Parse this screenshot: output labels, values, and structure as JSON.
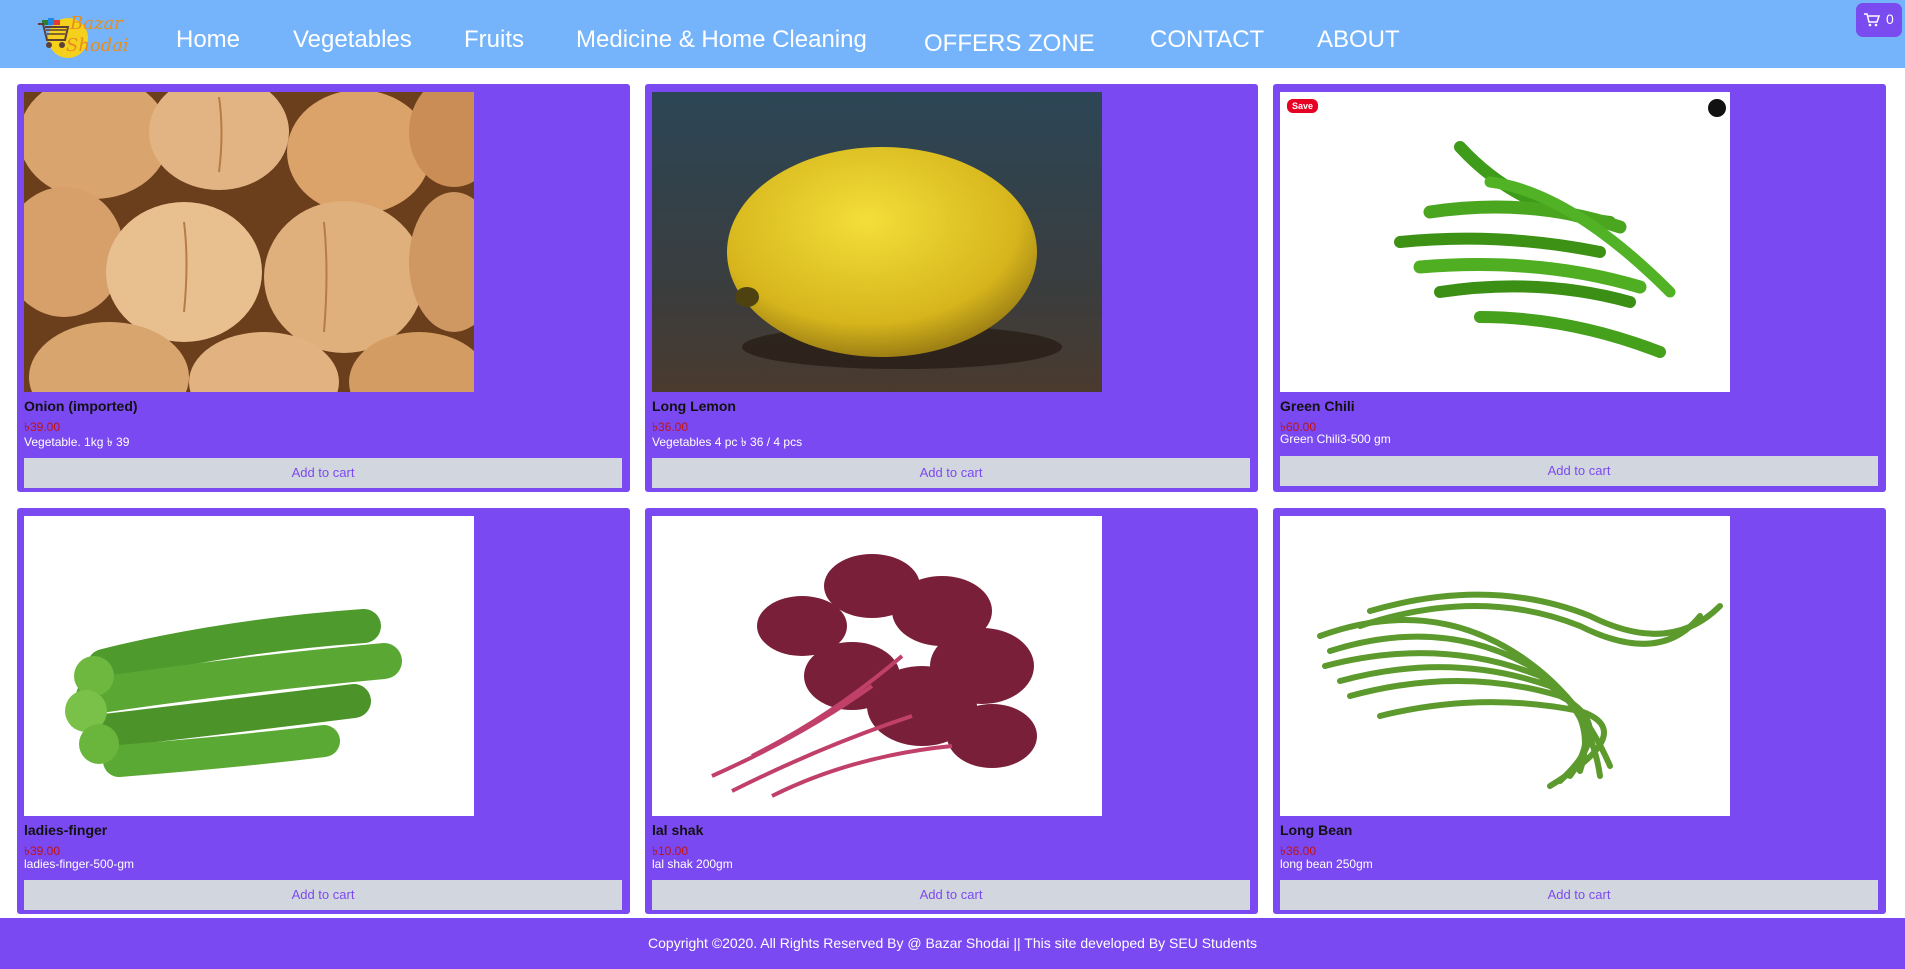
{
  "brand": {
    "line1": "Bazar",
    "line2": "Shodai"
  },
  "nav": {
    "home": "Home",
    "vegetables": "Vegetables",
    "fruits": "Fruits",
    "medicine": "Medicine & Home Cleaning",
    "offers": "OFFERS ZONE",
    "contact": "CONTACT",
    "about": "ABOUT"
  },
  "cart": {
    "count": "0"
  },
  "products": [
    {
      "name": "Onion (imported)",
      "price": "৳39.00",
      "desc": "Vegetable. 1kg ৳ 39",
      "button": "Add to cart"
    },
    {
      "name": "Long Lemon",
      "price": "৳36.00",
      "desc": "Vegetables 4 pc ৳ 36 / 4 pcs",
      "button": "Add to cart"
    },
    {
      "name": "Green Chili",
      "price": "৳60.00",
      "desc": "Green Chili3-500 gm",
      "button": "Add to cart",
      "pin_label": "Save"
    },
    {
      "name": "ladies-finger",
      "price": "৳39.00",
      "desc": "ladies-finger-500-gm",
      "button": "Add to cart"
    },
    {
      "name": "lal shak",
      "price": "৳10.00",
      "desc": "lal shak 200gm",
      "button": "Add to cart"
    },
    {
      "name": "Long Bean",
      "price": "৳36.00",
      "desc": "long bean 250gm",
      "button": "Add to cart"
    }
  ],
  "footer": {
    "text": "Copyright ©2020. All Rights Reserved By @ Bazar Shodai || This site developed By SEU Students"
  },
  "colors": {
    "nav_bg": "#75b4fb",
    "card_bg": "#7b49f1",
    "button_bg": "#d2d6de",
    "price": "#c01313"
  }
}
